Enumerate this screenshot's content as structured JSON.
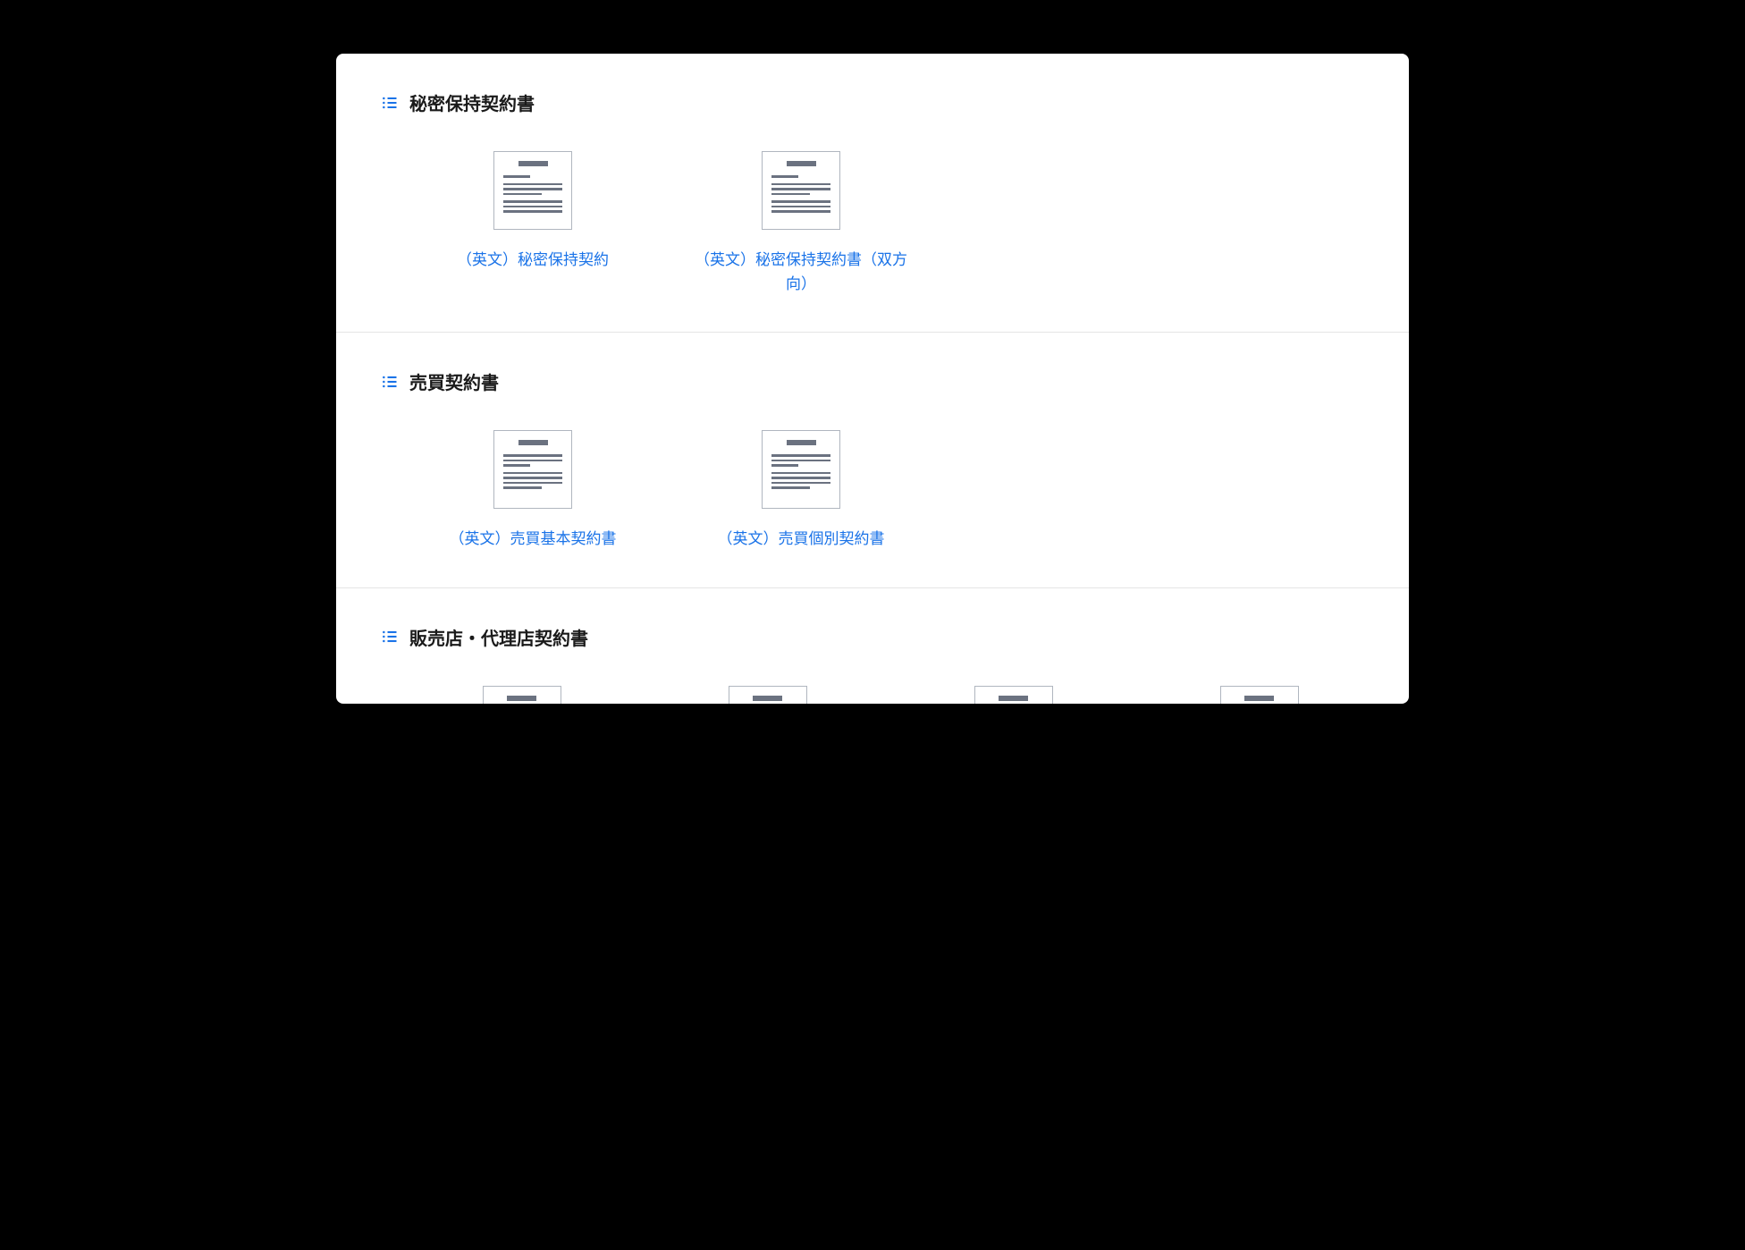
{
  "sections": [
    {
      "title": "秘密保持契約書",
      "items": [
        {
          "label": "（英文）秘密保持契約"
        },
        {
          "label": "（英文）秘密保持契約書（双方向）"
        }
      ]
    },
    {
      "title": "売買契約書",
      "items": [
        {
          "label": "（英文）売買基本契約書"
        },
        {
          "label": "（英文）売買個別契約書"
        }
      ]
    },
    {
      "title": "販売店・代理店契約書",
      "items": [
        {
          "label": ""
        },
        {
          "label": ""
        },
        {
          "label": ""
        },
        {
          "label": ""
        }
      ]
    }
  ]
}
